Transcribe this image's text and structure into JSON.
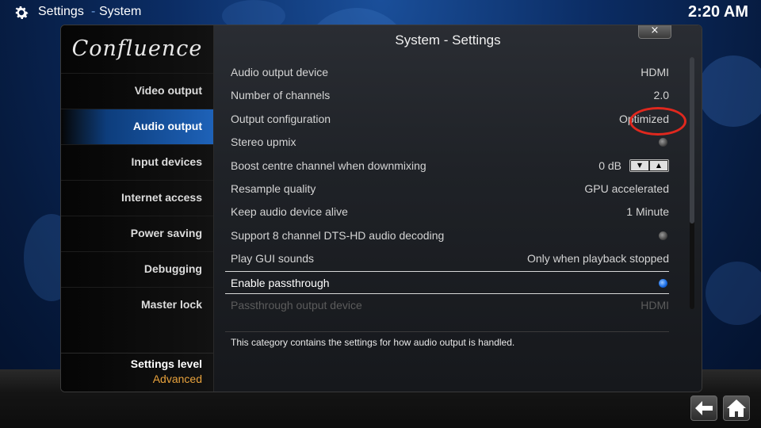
{
  "header": {
    "section": "Settings",
    "separator": "-",
    "subsection": "System",
    "clock": "2:20 AM"
  },
  "sidebar": {
    "logo": "Confluence",
    "items": [
      {
        "label": "Video output",
        "active": false
      },
      {
        "label": "Audio output",
        "active": true
      },
      {
        "label": "Input devices",
        "active": false
      },
      {
        "label": "Internet access",
        "active": false
      },
      {
        "label": "Power saving",
        "active": false
      },
      {
        "label": "Debugging",
        "active": false
      },
      {
        "label": "Master lock",
        "active": false
      }
    ],
    "settings_level": {
      "title": "Settings level",
      "value": "Advanced"
    }
  },
  "dialog": {
    "title": "System - Settings",
    "close_glyph": "×",
    "settings": [
      {
        "label": "Audio output device",
        "value": "HDMI"
      },
      {
        "label": "Number of channels",
        "value": "2.0"
      },
      {
        "label": "Output configuration",
        "value": "Optimized"
      },
      {
        "label": "Stereo upmix",
        "toggle": "off"
      },
      {
        "label": "Boost centre channel when downmixing",
        "value": "0 dB"
      },
      {
        "label": "Resample quality",
        "value": "GPU accelerated"
      },
      {
        "label": "Keep audio device alive",
        "value": "1 Minute"
      },
      {
        "label": "Support 8 channel DTS-HD audio decoding",
        "toggle": "off"
      },
      {
        "label": "Play GUI sounds",
        "value": "Only when playback stopped"
      },
      {
        "label": "Enable passthrough",
        "toggle": "on",
        "focused": true
      },
      {
        "label": "Passthrough output device",
        "value": "HDMI",
        "disabled": true
      }
    ],
    "description": "This category contains the settings for how audio output is handled."
  },
  "nav": {
    "back_icon": "back-arrow-icon",
    "home_icon": "home-icon"
  },
  "colors": {
    "accent_orange": "#e8a23c",
    "selection_blue": "#1e62b8",
    "annotation_red": "#e0281e"
  }
}
